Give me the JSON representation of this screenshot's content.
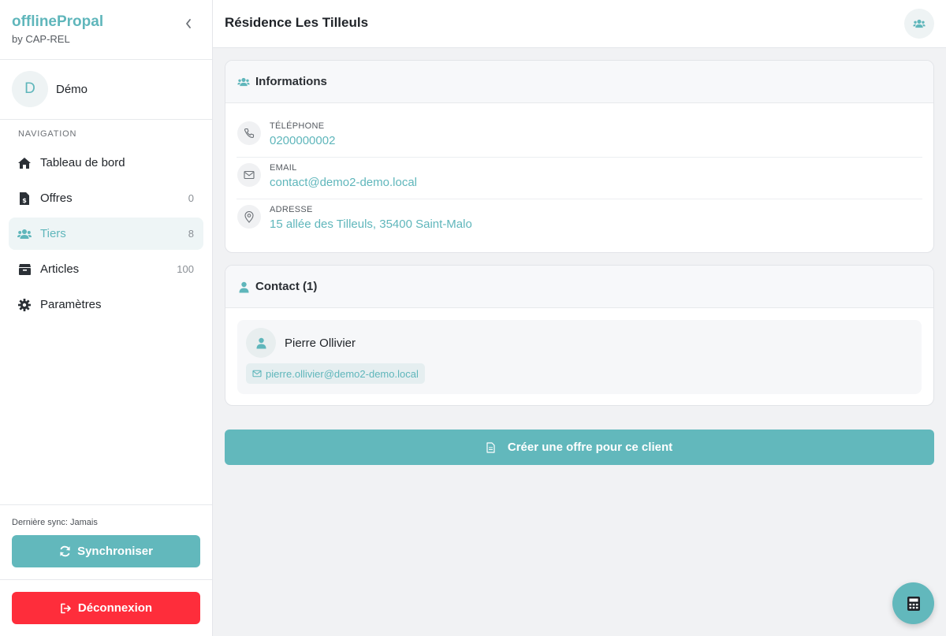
{
  "app": {
    "name": "offlinePropal",
    "subtitle": "by CAP-REL"
  },
  "user": {
    "initial": "D",
    "name": "Démo"
  },
  "navigation": {
    "title": "NAVIGATION",
    "items": [
      {
        "label": "Tableau de bord",
        "icon": "home-icon",
        "count": ""
      },
      {
        "label": "Offres",
        "icon": "invoice-icon",
        "count": "0"
      },
      {
        "label": "Tiers",
        "icon": "users-icon",
        "count": "8",
        "active": true
      },
      {
        "label": "Articles",
        "icon": "box-icon",
        "count": "100"
      },
      {
        "label": "Paramètres",
        "icon": "gear-icon",
        "count": ""
      }
    ]
  },
  "sync": {
    "last_sync": "Dernière sync: Jamais",
    "button_label": "Synchroniser"
  },
  "logout": {
    "button_label": "Déconnexion"
  },
  "header": {
    "title": "Résidence Les Tilleuls"
  },
  "informations": {
    "title": "Informations",
    "phone": {
      "label": "TÉLÉPHONE",
      "value": "0200000002"
    },
    "email": {
      "label": "EMAIL",
      "value": "contact@demo2-demo.local"
    },
    "address": {
      "label": "ADRESSE",
      "value": "15 allée des Tilleuls, 35400 Saint-Malo"
    }
  },
  "contacts": {
    "title": "Contact (1)",
    "items": [
      {
        "name": "Pierre Ollivier",
        "email": "pierre.ollivier@demo2-demo.local"
      }
    ]
  },
  "create_offer": {
    "label": "Créer une offre pour ce client"
  },
  "colors": {
    "accent": "#5fb6bb",
    "danger": "#fe2d3b",
    "button": "#62b8bc"
  }
}
